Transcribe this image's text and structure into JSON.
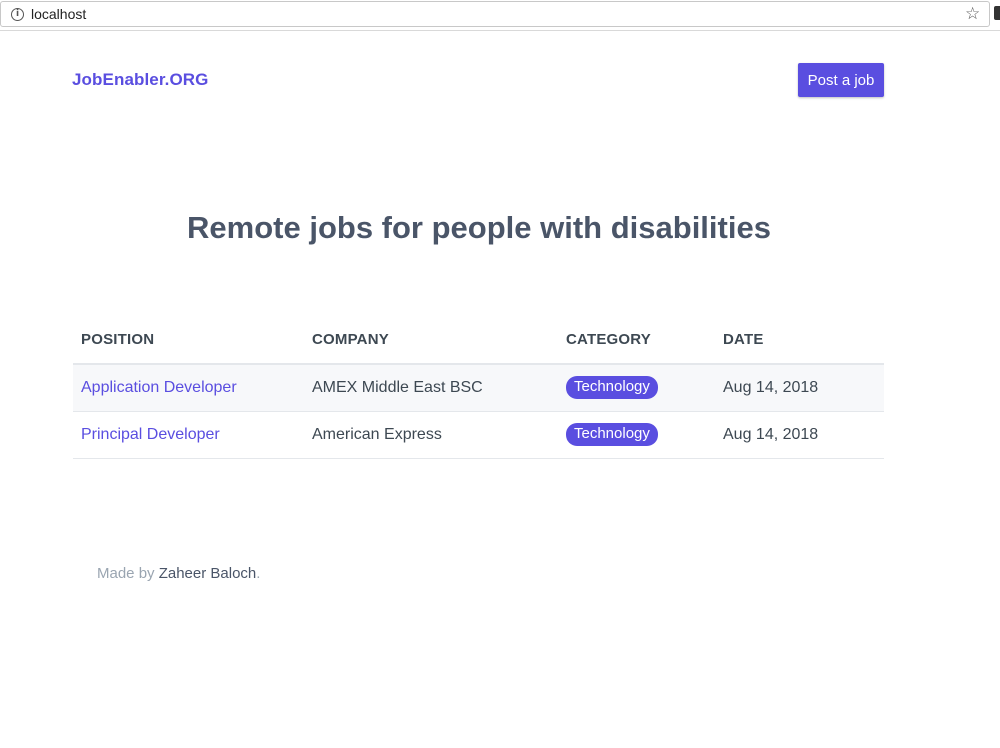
{
  "browser": {
    "url": "localhost"
  },
  "header": {
    "brand": "JobEnabler.ORG",
    "post_button": "Post a job"
  },
  "hero": {
    "title": "Remote jobs for people with disabilities"
  },
  "table": {
    "columns": [
      "POSITION",
      "COMPANY",
      "CATEGORY",
      "DATE"
    ],
    "rows": [
      {
        "position": "Application Developer",
        "company": "AMEX Middle East BSC",
        "category": "Technology",
        "date": "Aug 14, 2018"
      },
      {
        "position": "Principal Developer",
        "company": "American Express",
        "category": "Technology",
        "date": "Aug 14, 2018"
      }
    ]
  },
  "footer": {
    "prefix": "Made by ",
    "author": "Zaheer Baloch",
    "suffix": "."
  },
  "colors": {
    "accent": "#5a4ee0",
    "heading": "#4a5568",
    "muted": "#9aa5b1"
  }
}
